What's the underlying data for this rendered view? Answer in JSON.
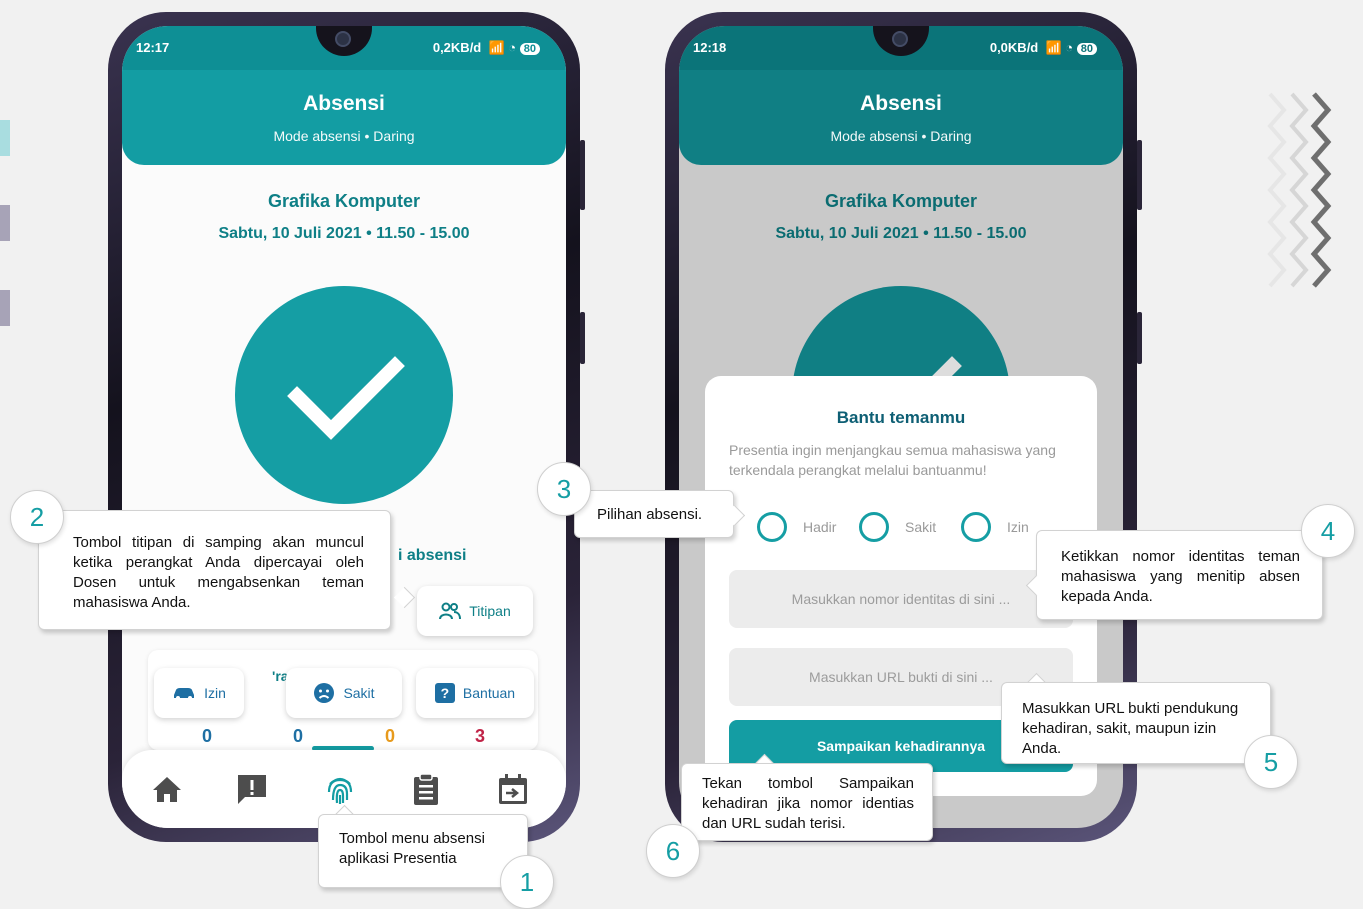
{
  "colors": {
    "teal": "#139da3",
    "teal_dark": "#0e7f86",
    "red": "#c02347",
    "orange": "#e79a1c",
    "blue": "#1e6fa3"
  },
  "phone_left": {
    "status_time": "12:17",
    "status_right": "0,2KB/d",
    "battery": "80",
    "header_title": "Absensi",
    "header_mode": "Mode absensi • Daring",
    "course_name": "Grafika Komputer",
    "course_schedule": "Sabtu, 10 Juli 2021 • 11.50 - 15.00",
    "partial_label": "i absensi",
    "titipan_label": "Titipan",
    "partial_section": "'ra",
    "chips": [
      {
        "label": "Izin",
        "icon": "car-icon",
        "count": "0"
      },
      {
        "label": "Sakit",
        "icon": "sad-face-icon",
        "count": "0"
      },
      {
        "label": "Bantuan",
        "icon": "help-icon",
        "count": "3"
      }
    ],
    "extra_count": "0",
    "nav_icons": [
      "home-icon",
      "report-icon",
      "fingerprint-icon",
      "clipboard-icon",
      "calendar-icon"
    ]
  },
  "phone_right": {
    "status_time": "12:18",
    "status_right": "0,0KB/d",
    "battery": "80",
    "header_title": "Absensi",
    "header_mode": "Mode absensi • Daring",
    "course_name": "Grafika Komputer",
    "course_schedule": "Sabtu, 10 Juli 2021 • 11.50 - 15.00",
    "dialog": {
      "title": "Bantu temanmu",
      "description": "Presentia ingin menjangkau semua mahasiswa yang terkendala perangkat melalui bantuanmu!",
      "options": [
        "Hadir",
        "Sakit",
        "Izin"
      ],
      "id_placeholder": "Masukkan nomor identitas di sini ...",
      "url_placeholder": "Masukkan URL bukti di sini ...",
      "submit_label": "Sampaikan kehadirannya"
    }
  },
  "callouts": [
    {
      "number": "1",
      "text": "Tombol menu absensi aplikasi Presentia"
    },
    {
      "number": "2",
      "text": "Tombol titipan di samping akan muncul ketika perangkat Anda dipercayai oleh Dosen untuk mengabsenkan teman mahasiswa Anda."
    },
    {
      "number": "3",
      "text": "Pilihan absensi."
    },
    {
      "number": "4",
      "text": "Ketikkan nomor identitas teman mahasiswa yang menitip absen kepada Anda."
    },
    {
      "number": "5",
      "text": "Masukkan URL bukti pendukung kehadiran, sakit, maupun izin Anda."
    },
    {
      "number": "6",
      "text": "Tekan tombol Sampaikan kehadiran jika nomor identias dan URL sudah terisi."
    }
  ]
}
